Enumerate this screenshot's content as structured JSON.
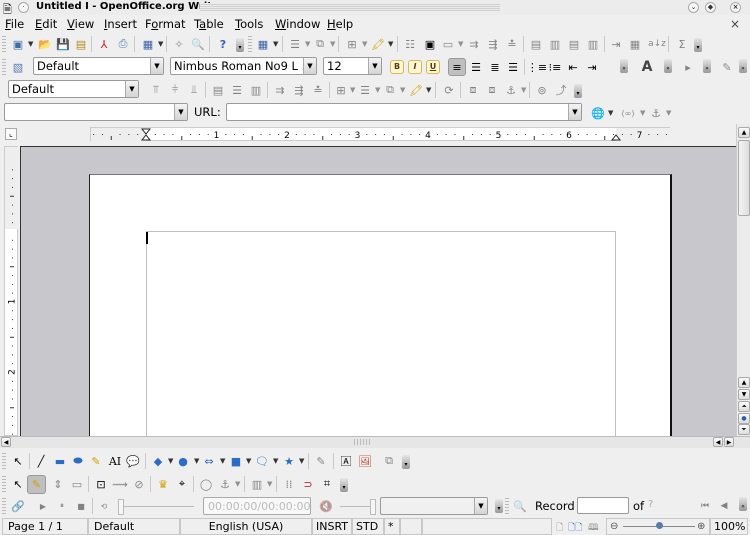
{
  "window": {
    "title": "Untitled I - OpenOffice.org Writer",
    "controls": [
      "minimize",
      "maximize",
      "close"
    ],
    "doc_close": "×"
  },
  "menubar": {
    "items": [
      {
        "label": "File",
        "accel": "F"
      },
      {
        "label": "Edit",
        "accel": "E"
      },
      {
        "label": "View",
        "accel": "V"
      },
      {
        "label": "Insert",
        "accel": "I"
      },
      {
        "label": "Format",
        "accel": "o"
      },
      {
        "label": "Table",
        "accel": "a"
      },
      {
        "label": "Tools",
        "accel": "T"
      },
      {
        "label": "Window",
        "accel": "W"
      },
      {
        "label": "Help",
        "accel": "H"
      }
    ]
  },
  "standard_toolbar": {
    "icons": [
      "new-document",
      "open",
      "save",
      "edit-file",
      "export-pdf",
      "print",
      "insert-table",
      "navigator",
      "zoom",
      "help",
      "more",
      "table-dropdown",
      "borders",
      "cell-merge",
      "insert-rows",
      "background-color",
      "split-cells",
      "optimal",
      "insert-rows-above",
      "insert-rows-below",
      "delete-rows",
      "delete-columns",
      "select-table",
      "cell-properties",
      "column-width",
      "row-height",
      "sort",
      "sum",
      "more"
    ]
  },
  "formatting_toolbar": {
    "paragraph_style": "Default",
    "font_name": "Nimbus Roman No9 L",
    "font_size": "12",
    "bold": "B",
    "italic": "I",
    "underline": "U",
    "active_alignment": "left"
  },
  "table_toolbar": {
    "table_style": "Default"
  },
  "hyperlink_bar": {
    "text_value": "",
    "url_label": "URL:",
    "url_value": ""
  },
  "rulers": {
    "horizontal_labels": [
      "1",
      "2",
      "3",
      "4",
      "5",
      "6",
      "7"
    ],
    "vertical_labels": [
      "1",
      "2"
    ]
  },
  "drawing_toolbar": {
    "text_tool": "AI"
  },
  "media_toolbar": {
    "time": "00:00:00/00:00:00"
  },
  "form_nav": {
    "record_label": "Record",
    "record_value": "",
    "of_label": "of",
    "of_value": "?"
  },
  "statusbar": {
    "page": "Page 1 / 1",
    "style": "Default",
    "language": "English (USA)",
    "insert_mode": "INSRT",
    "selection_mode": "STD",
    "modified": "*",
    "zoom": "100%",
    "zoom_fraction": 0.5
  }
}
